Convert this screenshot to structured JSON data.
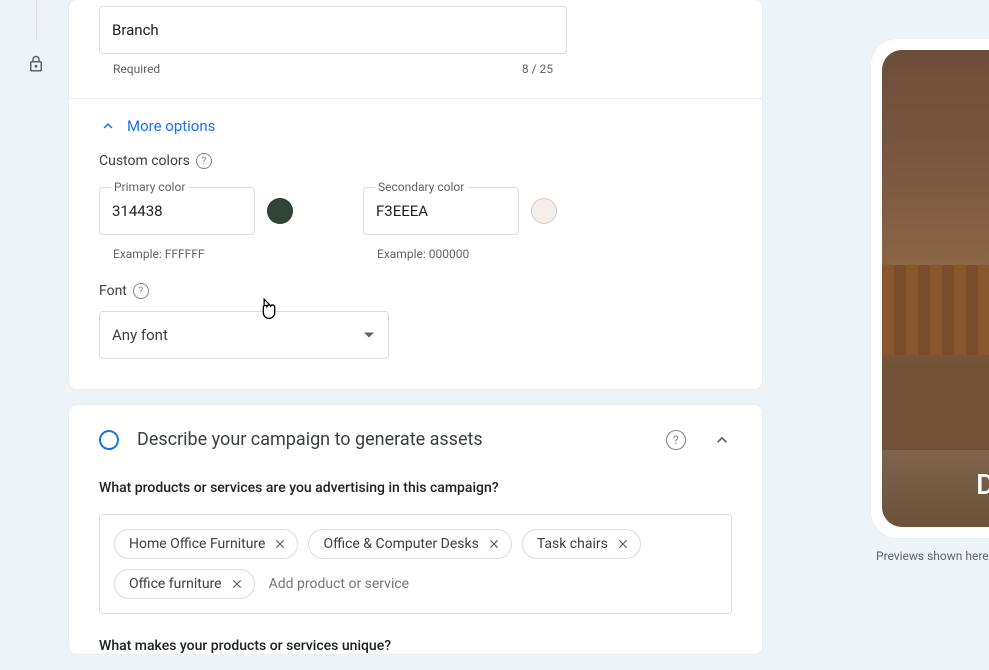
{
  "branch": {
    "value": "Branch",
    "required_label": "Required",
    "counter": "8 / 25"
  },
  "more_options": {
    "label": "More options"
  },
  "custom_colors_label": "Custom colors",
  "primary_color": {
    "label": "Primary color",
    "value": "314438",
    "example": "Example: FFFFFF",
    "swatch_hex": "#314438"
  },
  "secondary_color": {
    "label": "Secondary color",
    "value": "F3EEEA",
    "example": "Example: 000000",
    "swatch_hex": "#F3EEEA"
  },
  "font": {
    "label": "Font",
    "value": "Any font"
  },
  "describe": {
    "title": "Describe your campaign to generate assets",
    "q_products": "What products or services are you advertising in this campaign?",
    "chips": [
      "Home Office Furniture",
      "Office & Computer Desks",
      "Task chairs",
      "Office furniture"
    ],
    "add_placeholder": "Add product or service",
    "q_unique": "What makes your products or services unique?"
  },
  "preview": {
    "ad_text": "Des",
    "note": "Previews shown here are ex"
  }
}
